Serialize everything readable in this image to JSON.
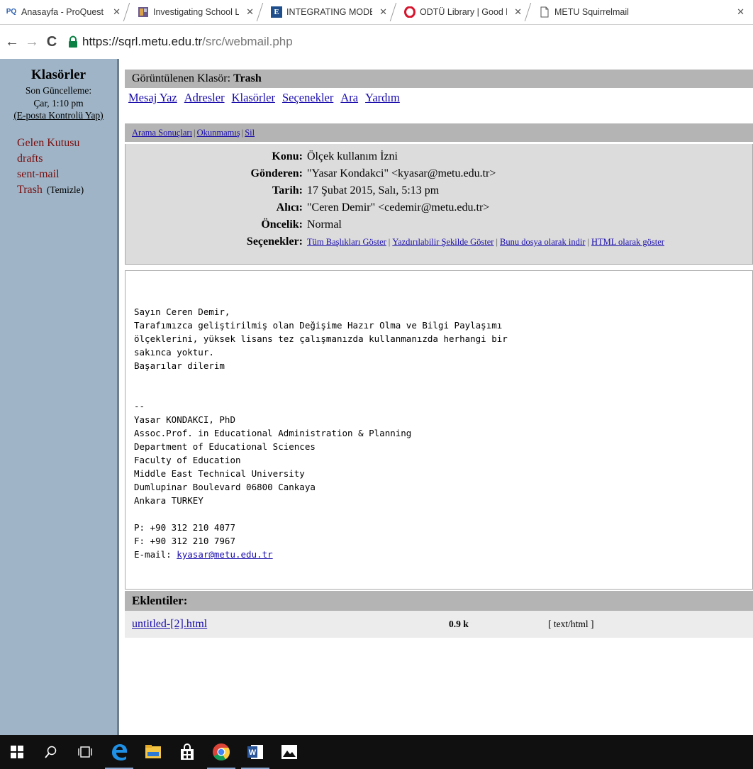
{
  "browser": {
    "tabs": [
      {
        "title": "Anasayfa - ProQuest Disse",
        "icon": "proquest-icon",
        "favicon_text": "PQ"
      },
      {
        "title": "Investigating School Lead",
        "icon": "journal-icon"
      },
      {
        "title": "INTEGRATING MODERATI",
        "icon": "eric-icon",
        "favicon_text": "E"
      },
      {
        "title": "ODTÜ Library | Good libra",
        "icon": "opera-icon"
      },
      {
        "title": "METU Squirrelmail",
        "icon": "page-icon",
        "active": true
      }
    ],
    "url_host": "https://sqrl.metu.edu.tr",
    "url_path": "/src/webmail.php"
  },
  "sidebar": {
    "title": "Klasörler",
    "updated_label": "Son Güncelleme:",
    "updated_time": "Çar, 1:10 pm",
    "check_mail": "(E-posta Kontrolü Yap)",
    "folders": [
      {
        "name": "Gelen Kutusu"
      },
      {
        "name": "drafts"
      },
      {
        "name": "sent-mail"
      },
      {
        "name": "Trash",
        "purge": "(Temizle)"
      }
    ]
  },
  "folder_bar": {
    "label": "Görüntülenen Klasör:",
    "folder": "Trash"
  },
  "menu": [
    "Mesaj Yaz",
    "Adresler",
    "Klasörler",
    "Seçenekler",
    "Ara",
    "Yardım"
  ],
  "actions": [
    "Arama Sonuçları",
    "Okunmamış",
    "Sil"
  ],
  "headers": {
    "subject_label": "Konu:",
    "subject": "Ölçek kullanım İzni",
    "from_label": "Gönderen:",
    "from": "\"Yasar Kondakci\" <kyasar@metu.edu.tr>",
    "date_label": "Tarih:",
    "date": "17 Şubat 2015, Salı, 5:13 pm",
    "to_label": "Alıcı:",
    "to": "\"Ceren Demir\" <cedemir@metu.edu.tr>",
    "priority_label": "Öncelik:",
    "priority": "Normal",
    "options_label": "Seçenekler:",
    "options": [
      "Tüm Başlıkları Göster",
      "Yazdırılabilir Şekilde Göster",
      "Bunu dosya olarak indir",
      "HTML olarak göster"
    ]
  },
  "body": {
    "lines": [
      "Sayın Ceren Demir,",
      "Tarafımızca geliştirilmiş olan Değişime Hazır Olma ve Bilgi Paylaşımı",
      "ölçeklerini, yüksek lisans tez çalışmanızda kullanmanızda herhangi bir",
      "sakınca yoktur.",
      "Başarılar dilerim",
      "",
      "",
      "--",
      "Yasar KONDAKCI, PhD",
      "Assoc.Prof. in Educational Administration & Planning",
      "Department of Educational Sciences",
      "Faculty of Education",
      "Middle East Technical University",
      "Dumlupinar Boulevard 06800 Cankaya",
      "Ankara TURKEY",
      "",
      "P: +90 312 210 4077",
      "F: +90 312 210 7967"
    ],
    "email_label": "E-mail: ",
    "email_link": "kyasar@metu.edu.tr"
  },
  "attachments": {
    "title": "Eklentiler:",
    "items": [
      {
        "name": "untitled-[2].html",
        "size": "0.9 k",
        "type": "[ text/html ]"
      }
    ]
  },
  "taskbar": {
    "icons": [
      "windows-start-icon",
      "search-icon",
      "task-view-icon",
      "edge-icon",
      "file-explorer-icon",
      "store-icon",
      "chrome-icon",
      "word-icon",
      "photos-icon"
    ]
  },
  "colors": {
    "sidebar_bg": "#9fb5c7",
    "folder_text": "#7a0d0d",
    "link": "#1a0dab",
    "bar_bg": "#b4b4b4",
    "header_bg": "#dcdcdc"
  }
}
